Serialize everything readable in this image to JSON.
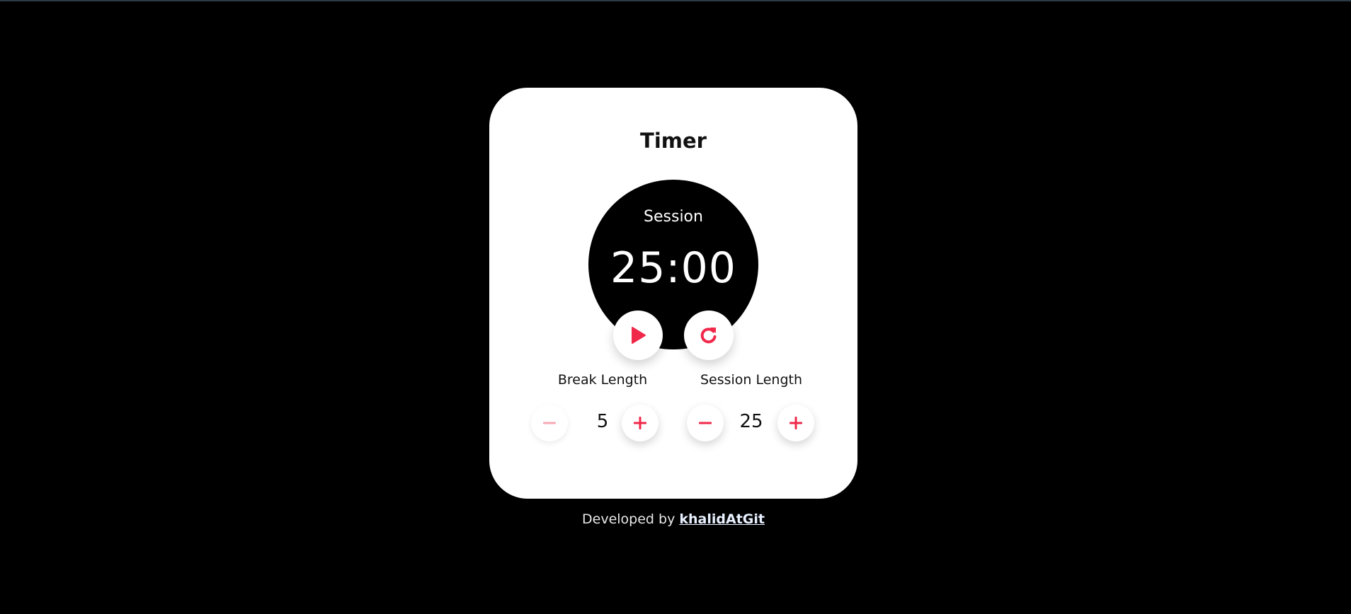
{
  "app": {
    "title": "Timer"
  },
  "clock": {
    "label": "Session",
    "time": "25:00"
  },
  "controls": {
    "play_icon": "play-icon",
    "reset_icon": "reset-icon"
  },
  "break_length": {
    "label": "Break Length",
    "value": "5",
    "decrement_icon": "minus-icon",
    "increment_icon": "plus-icon"
  },
  "session_length": {
    "label": "Session Length",
    "value": "25",
    "decrement_icon": "minus-icon",
    "increment_icon": "plus-icon"
  },
  "footer": {
    "prefix": "Developed by",
    "link_text": "khalidAtGit"
  },
  "colors": {
    "background": "#000000",
    "card": "#ffffff",
    "accent": "#f0284a",
    "accent_disabled": "#f7a9b6"
  }
}
